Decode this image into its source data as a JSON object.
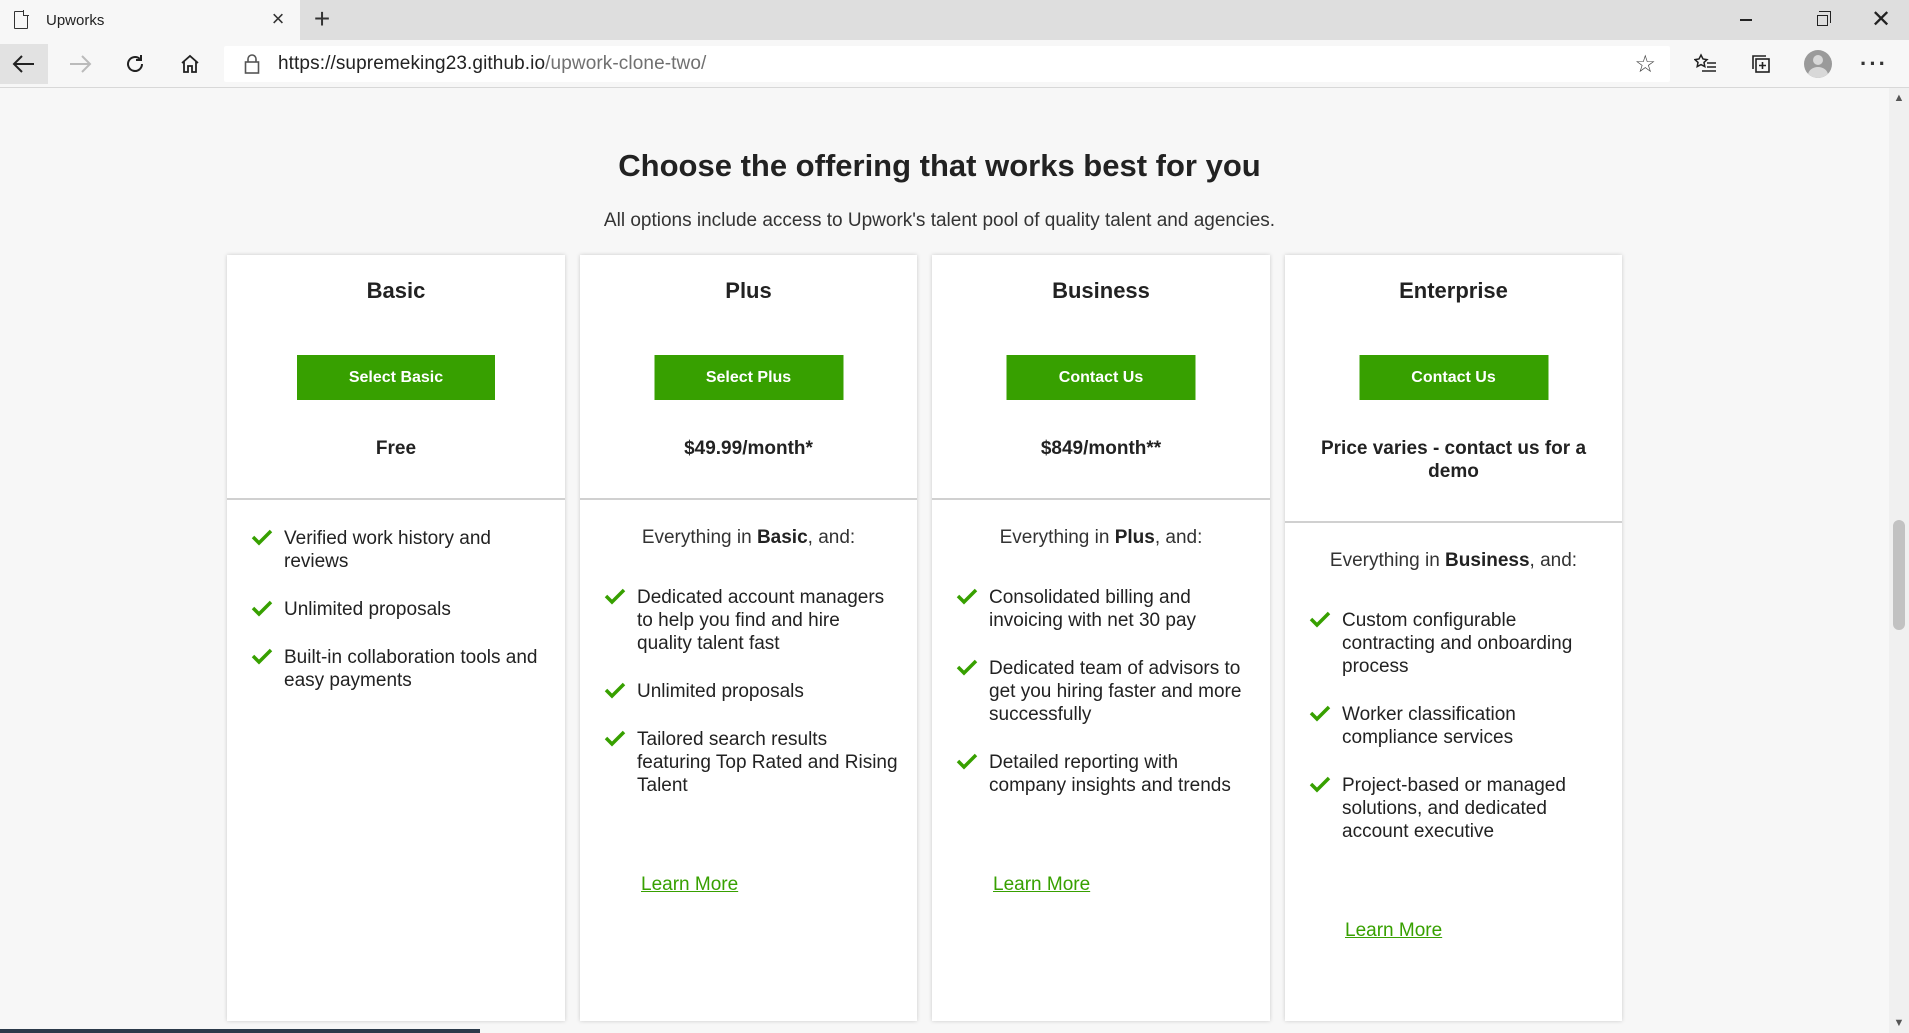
{
  "browser": {
    "tab_title": "Upworks",
    "url_host": "https://supremeking23.github.io",
    "url_path": "/upwork-clone-two/"
  },
  "page": {
    "heading": "Choose the offering that works best for you",
    "subheading": "All options include access to Upwork's talent pool of quality talent and agencies."
  },
  "plans": [
    {
      "name": "Basic",
      "button": "Select Basic",
      "price": "Free",
      "features": [
        "Verified work history and reviews",
        "Unlimited proposals",
        "Built-in collaboration tools and easy payments"
      ]
    },
    {
      "name": "Plus",
      "button": "Select Plus",
      "price": "$49.99/month*",
      "everything_prefix": "Everything in ",
      "everything_plan": "Basic",
      "everything_suffix": ", and:",
      "features": [
        "Dedicated account managers to help you find and hire quality talent fast",
        "Unlimited proposals",
        "Tailored search results featuring Top Rated and Rising Talent"
      ],
      "learn_more": "Learn More"
    },
    {
      "name": "Business",
      "button": "Contact Us",
      "price": "$849/month**",
      "everything_prefix": "Everything in ",
      "everything_plan": "Plus",
      "everything_suffix": ", and:",
      "features": [
        "Consolidated billing and invoicing with net 30 pay",
        "Dedicated team of advisors to get you hiring faster and more successfully",
        "Detailed reporting with company insights and trends"
      ],
      "learn_more": "Learn More"
    },
    {
      "name": "Enterprise",
      "button": "Contact Us",
      "price": "Price varies - contact us for a demo",
      "everything_prefix": "Everything in ",
      "everything_plan": "Business",
      "everything_suffix": ", and:",
      "features": [
        "Custom configurable contracting and onboarding process",
        "Worker classification compliance services",
        "Project-based or managed solutions, and dedicated account executive"
      ],
      "learn_more": "Learn More"
    }
  ],
  "colors": {
    "accent_green": "#37a000",
    "check_green": "#37a000"
  }
}
